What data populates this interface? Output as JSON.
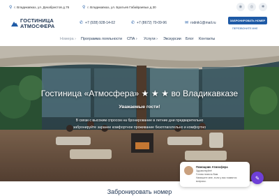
{
  "header": {
    "logo_line1": "ГОСТИНИЦА",
    "logo_line2": "АТМОСФЕРА",
    "address1": "г. Владикавказ, ул. Декабристов д.76",
    "address2": "г. Владикавказ, ул. Братьев Габайраевых д.30",
    "phone1": "+7 (928) 928-14-02",
    "phone2": "+7 (8672) 70-09-96",
    "email": "rodnik1@mail.ru",
    "book_button": "ЗАБРОНИРОВАТЬ НОМЕР",
    "callback": "ПЕРЕЗВОНИТЕ МНЕ"
  },
  "nav": {
    "items": [
      {
        "label": "Номера ›"
      },
      {
        "label": "Программа лояльности"
      },
      {
        "label": "СПА ›"
      },
      {
        "label": "Услуги ›"
      },
      {
        "label": "Экскурсии"
      },
      {
        "label": "Блог"
      },
      {
        "label": "Контакты"
      }
    ]
  },
  "hero": {
    "title": "Гостиница «Атмосфера» ★ ★ ★ во Владикавказе",
    "subtitle": "Уважаемые гости!",
    "line1": "В связи с высоким спросом на бронирование в летние дни предварительно",
    "line2": "забронируйте заранее комфортное проживание безотлагательно и комфортно"
  },
  "chat": {
    "name": "Помощник Атмосфера",
    "line1": "Здравствуйте!",
    "line2": "Готова помочь Вам.",
    "line3": "Напишите мне, если у вас появятся",
    "line4": "вопросы."
  },
  "section": {
    "title": "Забронировать номер"
  },
  "colors": {
    "brand_blue": "#1e5aa6",
    "text_dark": "#1f3553",
    "chat_purple": "#6e3fd6"
  }
}
